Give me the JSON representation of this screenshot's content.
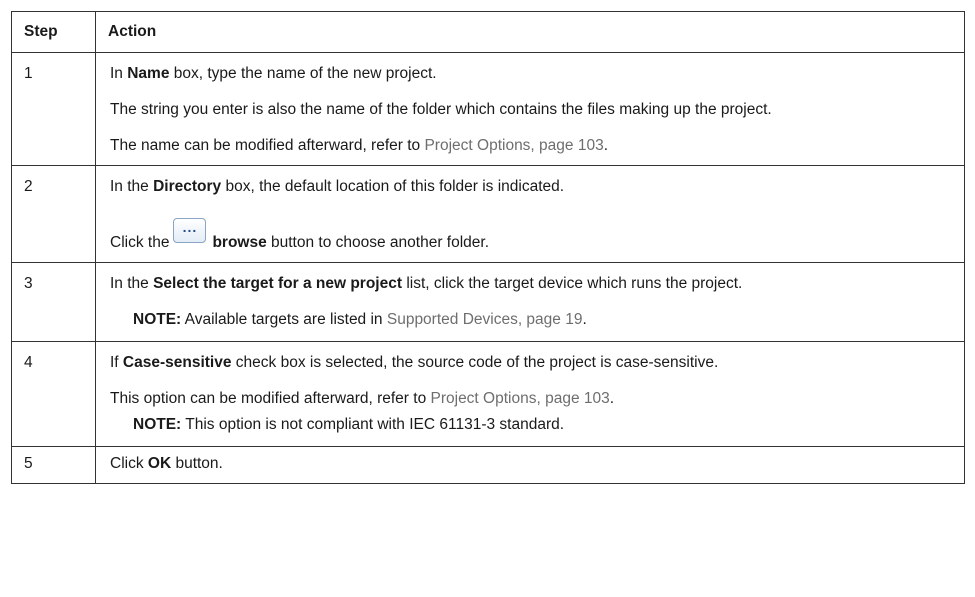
{
  "headers": {
    "step": "Step",
    "action": "Action"
  },
  "rows": [
    {
      "step": "1",
      "p1": {
        "a": "In ",
        "b": "Name",
        "c": " box, type the name of the new project."
      },
      "p2": "The string you enter is also the name of the folder which contains the files making up the project.",
      "p3": {
        "a": "The name can be modified afterward, refer to ",
        "link": "Project Options, page 103",
        "c": "."
      }
    },
    {
      "step": "2",
      "p1": {
        "a": "In the ",
        "b": "Directory",
        "c": " box, the default location of this folder is indicated."
      },
      "p2": {
        "a": "Click the",
        "button_icon": "ellipsis-browse-button",
        "button_glyph": "...",
        "b": "browse",
        "c": " button to choose another folder."
      }
    },
    {
      "step": "3",
      "p1": {
        "a": "In the ",
        "b": "Select the target for a new project",
        "c": " list, click the target device which runs the project."
      },
      "note": {
        "label": "NOTE:",
        "a": " Available targets are listed in ",
        "link": "Supported Devices, page 19",
        "c": "."
      }
    },
    {
      "step": "4",
      "p1": {
        "a": "If ",
        "b": "Case-sensitive",
        "c": " check box is selected, the source code of the project is case-sensitive."
      },
      "p2": {
        "a": "This option can be modified afterward, refer to ",
        "link": "Project Options, page 103",
        "c": "."
      },
      "note": {
        "label": "NOTE:",
        "a": " This option is not compliant with IEC 61131-3 standard."
      }
    },
    {
      "step": "5",
      "p1": {
        "a": "Click ",
        "b": "OK",
        "c": " button."
      }
    }
  ],
  "colors": {
    "link": "#6e6e6e",
    "border": "#333333",
    "text": "#1a1a1a"
  }
}
